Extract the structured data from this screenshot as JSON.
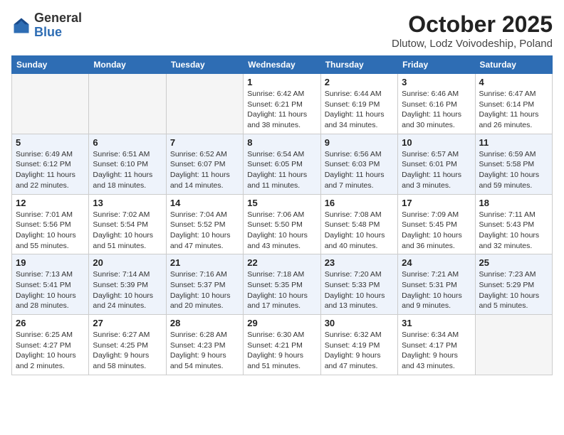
{
  "header": {
    "logo_general": "General",
    "logo_blue": "Blue",
    "month_title": "October 2025",
    "location": "Dlutow, Lodz Voivodeship, Poland"
  },
  "days_of_week": [
    "Sunday",
    "Monday",
    "Tuesday",
    "Wednesday",
    "Thursday",
    "Friday",
    "Saturday"
  ],
  "weeks": [
    [
      {
        "day": "",
        "info": ""
      },
      {
        "day": "",
        "info": ""
      },
      {
        "day": "",
        "info": ""
      },
      {
        "day": "1",
        "info": "Sunrise: 6:42 AM\nSunset: 6:21 PM\nDaylight: 11 hours\nand 38 minutes."
      },
      {
        "day": "2",
        "info": "Sunrise: 6:44 AM\nSunset: 6:19 PM\nDaylight: 11 hours\nand 34 minutes."
      },
      {
        "day": "3",
        "info": "Sunrise: 6:46 AM\nSunset: 6:16 PM\nDaylight: 11 hours\nand 30 minutes."
      },
      {
        "day": "4",
        "info": "Sunrise: 6:47 AM\nSunset: 6:14 PM\nDaylight: 11 hours\nand 26 minutes."
      }
    ],
    [
      {
        "day": "5",
        "info": "Sunrise: 6:49 AM\nSunset: 6:12 PM\nDaylight: 11 hours\nand 22 minutes."
      },
      {
        "day": "6",
        "info": "Sunrise: 6:51 AM\nSunset: 6:10 PM\nDaylight: 11 hours\nand 18 minutes."
      },
      {
        "day": "7",
        "info": "Sunrise: 6:52 AM\nSunset: 6:07 PM\nDaylight: 11 hours\nand 14 minutes."
      },
      {
        "day": "8",
        "info": "Sunrise: 6:54 AM\nSunset: 6:05 PM\nDaylight: 11 hours\nand 11 minutes."
      },
      {
        "day": "9",
        "info": "Sunrise: 6:56 AM\nSunset: 6:03 PM\nDaylight: 11 hours\nand 7 minutes."
      },
      {
        "day": "10",
        "info": "Sunrise: 6:57 AM\nSunset: 6:01 PM\nDaylight: 11 hours\nand 3 minutes."
      },
      {
        "day": "11",
        "info": "Sunrise: 6:59 AM\nSunset: 5:58 PM\nDaylight: 10 hours\nand 59 minutes."
      }
    ],
    [
      {
        "day": "12",
        "info": "Sunrise: 7:01 AM\nSunset: 5:56 PM\nDaylight: 10 hours\nand 55 minutes."
      },
      {
        "day": "13",
        "info": "Sunrise: 7:02 AM\nSunset: 5:54 PM\nDaylight: 10 hours\nand 51 minutes."
      },
      {
        "day": "14",
        "info": "Sunrise: 7:04 AM\nSunset: 5:52 PM\nDaylight: 10 hours\nand 47 minutes."
      },
      {
        "day": "15",
        "info": "Sunrise: 7:06 AM\nSunset: 5:50 PM\nDaylight: 10 hours\nand 43 minutes."
      },
      {
        "day": "16",
        "info": "Sunrise: 7:08 AM\nSunset: 5:48 PM\nDaylight: 10 hours\nand 40 minutes."
      },
      {
        "day": "17",
        "info": "Sunrise: 7:09 AM\nSunset: 5:45 PM\nDaylight: 10 hours\nand 36 minutes."
      },
      {
        "day": "18",
        "info": "Sunrise: 7:11 AM\nSunset: 5:43 PM\nDaylight: 10 hours\nand 32 minutes."
      }
    ],
    [
      {
        "day": "19",
        "info": "Sunrise: 7:13 AM\nSunset: 5:41 PM\nDaylight: 10 hours\nand 28 minutes."
      },
      {
        "day": "20",
        "info": "Sunrise: 7:14 AM\nSunset: 5:39 PM\nDaylight: 10 hours\nand 24 minutes."
      },
      {
        "day": "21",
        "info": "Sunrise: 7:16 AM\nSunset: 5:37 PM\nDaylight: 10 hours\nand 20 minutes."
      },
      {
        "day": "22",
        "info": "Sunrise: 7:18 AM\nSunset: 5:35 PM\nDaylight: 10 hours\nand 17 minutes."
      },
      {
        "day": "23",
        "info": "Sunrise: 7:20 AM\nSunset: 5:33 PM\nDaylight: 10 hours\nand 13 minutes."
      },
      {
        "day": "24",
        "info": "Sunrise: 7:21 AM\nSunset: 5:31 PM\nDaylight: 10 hours\nand 9 minutes."
      },
      {
        "day": "25",
        "info": "Sunrise: 7:23 AM\nSunset: 5:29 PM\nDaylight: 10 hours\nand 5 minutes."
      }
    ],
    [
      {
        "day": "26",
        "info": "Sunrise: 6:25 AM\nSunset: 4:27 PM\nDaylight: 10 hours\nand 2 minutes."
      },
      {
        "day": "27",
        "info": "Sunrise: 6:27 AM\nSunset: 4:25 PM\nDaylight: 9 hours\nand 58 minutes."
      },
      {
        "day": "28",
        "info": "Sunrise: 6:28 AM\nSunset: 4:23 PM\nDaylight: 9 hours\nand 54 minutes."
      },
      {
        "day": "29",
        "info": "Sunrise: 6:30 AM\nSunset: 4:21 PM\nDaylight: 9 hours\nand 51 minutes."
      },
      {
        "day": "30",
        "info": "Sunrise: 6:32 AM\nSunset: 4:19 PM\nDaylight: 9 hours\nand 47 minutes."
      },
      {
        "day": "31",
        "info": "Sunrise: 6:34 AM\nSunset: 4:17 PM\nDaylight: 9 hours\nand 43 minutes."
      },
      {
        "day": "",
        "info": ""
      }
    ]
  ]
}
